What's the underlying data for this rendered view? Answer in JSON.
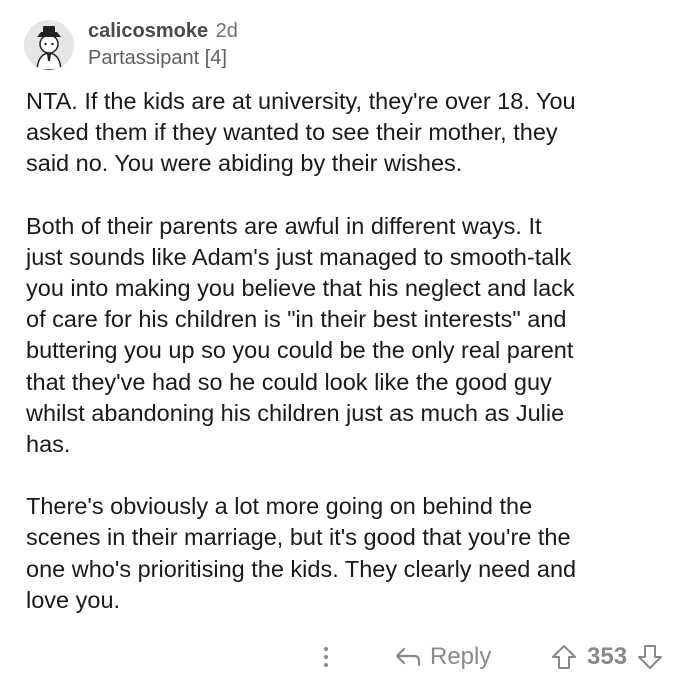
{
  "comment": {
    "username": "calicosmoke",
    "timestamp": "2d",
    "flair": "Partassipant [4]",
    "paragraphs": [
      "NTA. If the kids are at university, they're over 18. You\nasked them if they wanted to see their mother, they\nsaid no. You were abiding by their wishes.",
      "Both of their parents are awful in different ways. It\njust sounds like Adam's just managed to smooth-talk\nyou into making you believe that his neglect and lack\nof care for his children is \"in their best interests\" and\nbuttering you up so you could be the only real parent\nthat they've had so he could look like the good guy\nwhilst abandoning his children just as much as Julie\nhas.",
      "There's obviously a lot more going on behind the\nscenes in their marriage, but it's good that you're the\none who's prioritising the kids. They clearly need and\nlove you."
    ]
  },
  "actions": {
    "more_icon": "vertical-ellipsis-icon",
    "reply_icon": "reply-arrow-icon",
    "reply_label": "Reply",
    "upvote_icon": "upvote-arrow-icon",
    "vote_count": "353",
    "downvote_icon": "downvote-arrow-icon"
  },
  "colors": {
    "text": "#1a1a1b",
    "muted": "#878a8c",
    "username": "#4a4a4a"
  }
}
